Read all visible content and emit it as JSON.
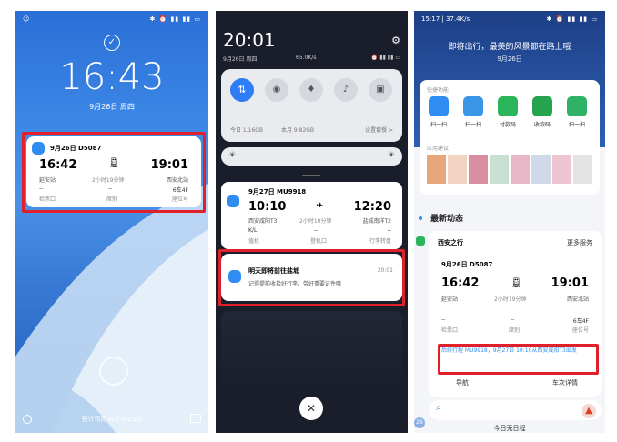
{
  "p1": {
    "time": "16:43",
    "date": "9月26日 周四",
    "card": {
      "title": "9月26日 D5087",
      "dep_time": "16:42",
      "arr_time": "19:01",
      "dep_station": "延安站",
      "duration": "2小时19分钟",
      "arr_station": "西安北站",
      "gate_val": "--",
      "gate_label": "检票口",
      "cabin_val": "--",
      "cabin_label": "席别",
      "seat_val": "6车4F",
      "seat_label": "座位号"
    },
    "footer": "预计可用36小时23分"
  },
  "p2": {
    "time": "20:01",
    "date": "9月26日 周四",
    "speed": "65.0K/s",
    "storage": "今日 1.16GB",
    "month": "本月 9.82GB",
    "settings": "设置套餐 >",
    "flight": {
      "title": "9月27日 MU9918",
      "dep_time": "10:10",
      "arr_time": "12:20",
      "dep_airport": "西安咸阳T3",
      "duration": "2小时10分钟",
      "arr_airport": "盐城南洋T2",
      "a_val": "K/L",
      "a_label": "值机",
      "b_val": "--",
      "b_label": "登机口",
      "c_val": "--",
      "c_label": "行李转盘"
    },
    "notice": {
      "title": "明天即将前往盐城",
      "time": "20:01",
      "body": "记得提前收拾好行李，带好重要证件哦"
    }
  },
  "p3": {
    "status": "15:17 | 37.4K/s",
    "slogan": "即将出行，最美的风景都在路上哦",
    "date": "9月26日",
    "quick_title": "快捷功能",
    "quick": [
      "扫一扫",
      "扫一扫",
      "付款码",
      "收款码",
      "扫一扫"
    ],
    "suggest_title": "应用建议",
    "news_title": "最新动态",
    "trip": {
      "header": "西安之行",
      "more": "更多服务",
      "title": "9月26日 D5087",
      "dep_time": "16:42",
      "arr_time": "19:01",
      "dep_station": "延安站",
      "duration": "2小时19分钟",
      "arr_station": "西安北站",
      "gate_val": "--",
      "gate_label": "检票口",
      "cabin_val": "--",
      "cabin_label": "席别",
      "seat_val": "6车4F",
      "seat_label": "座位号",
      "follow": "后续行程 MU9918，9月27日 10:10从西安咸阳T3出发",
      "nav": "导航",
      "detail": "车次详情"
    },
    "bottom": "今日无日程",
    "day_badge": "26"
  }
}
